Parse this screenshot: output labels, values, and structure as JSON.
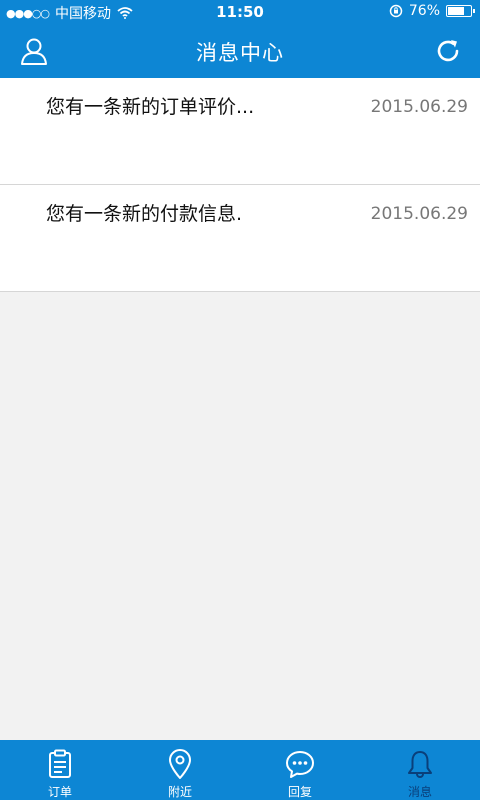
{
  "status": {
    "carrier": "中国移动",
    "time": "11:50",
    "battery_text": "76%",
    "battery_level": 0.76
  },
  "header": {
    "title": "消息中心"
  },
  "messages": [
    {
      "text": "您有一条新的订单评价...",
      "date": "2015.06.29"
    },
    {
      "text": "您有一条新的付款信息.",
      "date": "2015.06.29"
    }
  ],
  "tabs": [
    {
      "label": "订单",
      "icon": "clipboard-icon"
    },
    {
      "label": "附近",
      "icon": "location-pin-icon"
    },
    {
      "label": "回复",
      "icon": "chat-bubble-icon"
    },
    {
      "label": "消息",
      "icon": "bell-icon"
    }
  ],
  "colors": {
    "primary": "#0d86d4",
    "active_tab": "#0a3f7a"
  }
}
